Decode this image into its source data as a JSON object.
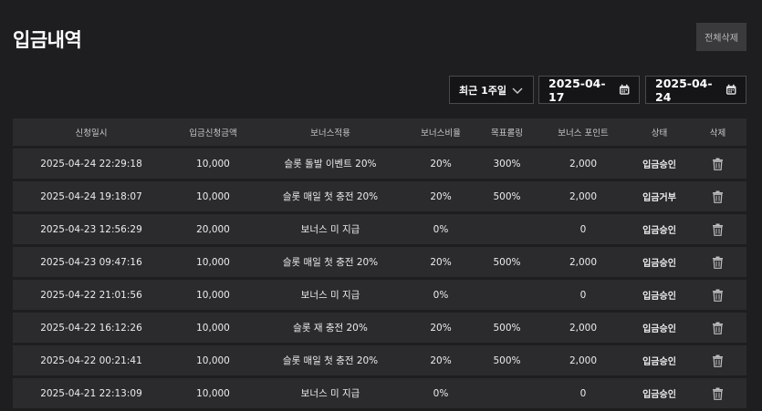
{
  "page": {
    "title": "입금내역",
    "delete_all_label": "전체삭제"
  },
  "filters": {
    "period": "최근 1주일",
    "date_from": "2025-04-17",
    "date_to": "2025-04-24"
  },
  "table": {
    "headers": [
      "신청일시",
      "입금신청금액",
      "보너스적용",
      "보너스비율",
      "목표롤링",
      "보너스 포인트",
      "상태",
      "삭제"
    ],
    "rows": [
      [
        "2025-04-24 22:29:18",
        "10,000",
        "슬롯 돌발 이벤트 20%",
        "20%",
        "300%",
        "2,000",
        "입금승인"
      ],
      [
        "2025-04-24 19:18:07",
        "10,000",
        "슬롯 매일 첫 충전 20%",
        "20%",
        "500%",
        "2,000",
        "입금거부"
      ],
      [
        "2025-04-23 12:56:29",
        "20,000",
        "보너스 미 지급",
        "0%",
        "",
        "0",
        "입금승인"
      ],
      [
        "2025-04-23 09:47:16",
        "10,000",
        "슬롯 매일 첫 충전 20%",
        "20%",
        "500%",
        "2,000",
        "입금승인"
      ],
      [
        "2025-04-22 21:01:56",
        "10,000",
        "보너스 미 지급",
        "0%",
        "",
        "0",
        "입금승인"
      ],
      [
        "2025-04-22 16:12:26",
        "10,000",
        "슬롯 재 충전 20%",
        "20%",
        "500%",
        "2,000",
        "입금승인"
      ],
      [
        "2025-04-22 00:21:41",
        "10,000",
        "슬롯 매일 첫 충전 20%",
        "20%",
        "500%",
        "2,000",
        "입금승인"
      ],
      [
        "2025-04-21 22:13:09",
        "10,000",
        "보너스 미 지급",
        "0%",
        "",
        "0",
        "입금승인"
      ]
    ]
  },
  "icons": {
    "trash": "trash-icon",
    "calendar": "calendar-icon",
    "chevron": "chevron-down-icon"
  }
}
